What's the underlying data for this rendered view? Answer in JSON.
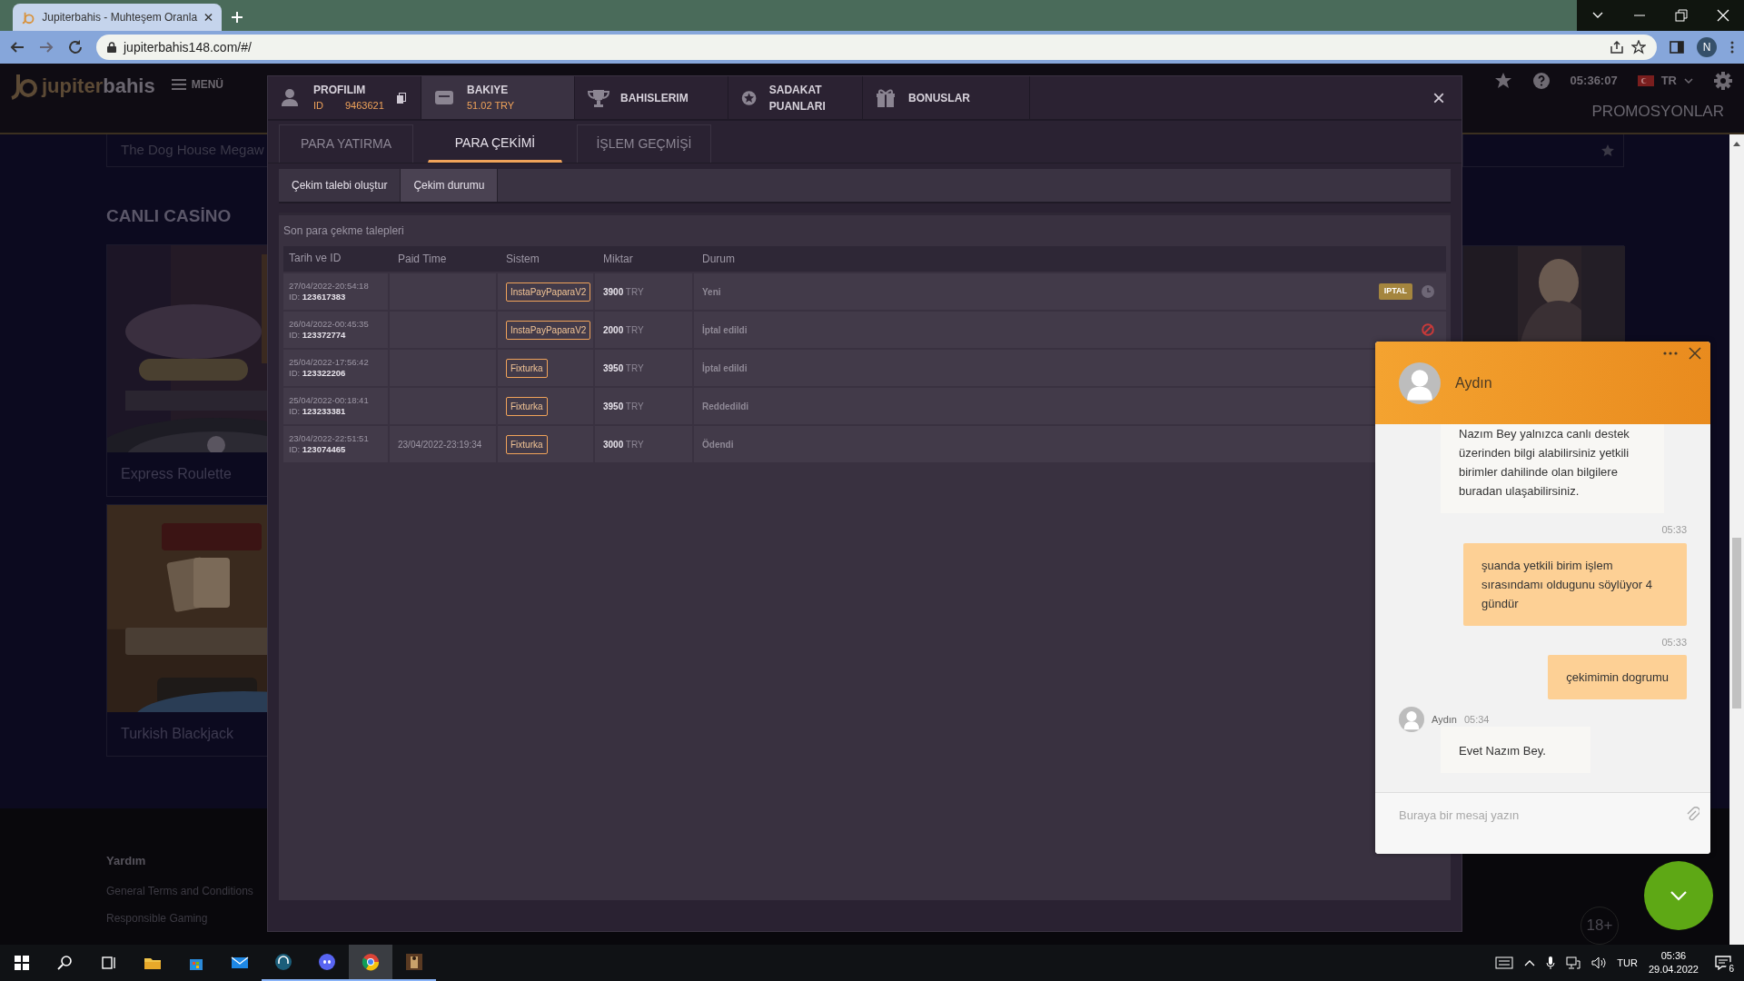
{
  "browser": {
    "tab_title": "Jupiterbahis - Muhteşem Oranla",
    "url": "jupiterbahis148.com/#/",
    "profile_initial": "N"
  },
  "site_header": {
    "logo_first": "jupiter",
    "logo_second": "bahis",
    "menu_label": "MENÜ",
    "clock": "05:36:07",
    "language": "TR",
    "promo_label": "PROMOSYONLAR"
  },
  "page": {
    "top_card_title": "The Dog House Megaw",
    "section_title": "CANLI CASİNO",
    "games": [
      {
        "title": "Express Roulette",
        "kind": "picture"
      },
      {
        "title": "Turkish Blackjack",
        "kind": "picture"
      }
    ]
  },
  "footer": {
    "heading": "Yardım",
    "links": [
      "General Terms and Conditions",
      "Responsible Gaming"
    ],
    "age_badge": "18+"
  },
  "modal": {
    "tabs": [
      {
        "label": "PROFILIM",
        "sub_label": "ID",
        "sub_value": "9463621",
        "selected": false
      },
      {
        "label": "BAKIYE",
        "sub_value": "51.02 TRY",
        "selected": true
      },
      {
        "label": "BAHISLERIM",
        "selected": false
      },
      {
        "label": "SADAKAT PUANLARI",
        "selected": false
      },
      {
        "label": "BONUSLAR",
        "selected": false
      }
    ],
    "close": "×",
    "sub_tabs": [
      {
        "label": "PARA YATIRMA",
        "selected": false
      },
      {
        "label": "PARA ÇEKİMİ",
        "selected": true
      },
      {
        "label": "İŞLEM GEÇMİŞİ",
        "selected": false
      }
    ],
    "views": [
      {
        "label": "Çekim talebi oluştur",
        "selected": false
      },
      {
        "label": "Çekim durumu",
        "selected": true
      }
    ],
    "section_title": "Son para çekme talepleri",
    "table": {
      "columns": [
        "Tarih ve ID",
        "Paid Time",
        "Sistem",
        "Miktar",
        "Durum"
      ],
      "rows": [
        {
          "date": "27/04/2022-20:54:18",
          "id": "ID: **123617383**",
          "system": "InstaPayPaparaV2",
          "amount": "**3900** TRY",
          "status": "Yeni",
          "kind": "cancellable",
          "action": "IPTAL"
        },
        {
          "date": "26/04/2022-00:45:35",
          "id": "ID: **123372774**",
          "system": "InstaPayPaparaV2",
          "amount": "**2000** TRY",
          "status": "İptal edildi",
          "kind": "cancelled"
        },
        {
          "date": "25/04/2022-17:56:42",
          "id": "ID: **123322206**",
          "system": "Fixturka",
          "amount": "**3950** TRY",
          "status": "İptal edildi",
          "kind": "plain"
        },
        {
          "date": "25/04/2022-00:18:41",
          "id": "ID: **123233381**",
          "system": "Fixturka",
          "amount": "**3950** TRY",
          "status": "Reddedildi",
          "kind": "plain"
        },
        {
          "date": "23/04/2022-22:51:51",
          "id": "ID: **123074465**",
          "paid_time": "23/04/2022-23:19:34",
          "system": "Fixturka",
          "amount": "**3000** TRY",
          "status": "Ödendi",
          "kind": "plain"
        }
      ]
    }
  },
  "chat": {
    "agent_name": "Aydın",
    "placeholder": "Buraya bir mesaj yazın",
    "messages": [
      {
        "kind": "agent",
        "text": "Nazım Bey yalnızca canlı destek üzerinden bilgi alabilirsiniz yetkili birimler dahilinde olan bilgilere buradan ulaşabilirsiniz."
      },
      {
        "kind": "user",
        "time": "05:33",
        "text": "şuanda yetkili birim işlem sırasındamı oldugunu söylüyor 4 gündür"
      },
      {
        "kind": "user",
        "time": "05:33",
        "text": "çekimimin dogrumu"
      },
      {
        "kind": "agent",
        "author": "Aydın",
        "time": "05:34",
        "text": "Evet Nazım Bey."
      }
    ]
  },
  "taskbar": {
    "language": "TUR",
    "time": "05:36",
    "date": "29.04.2022",
    "notifications": "6"
  }
}
